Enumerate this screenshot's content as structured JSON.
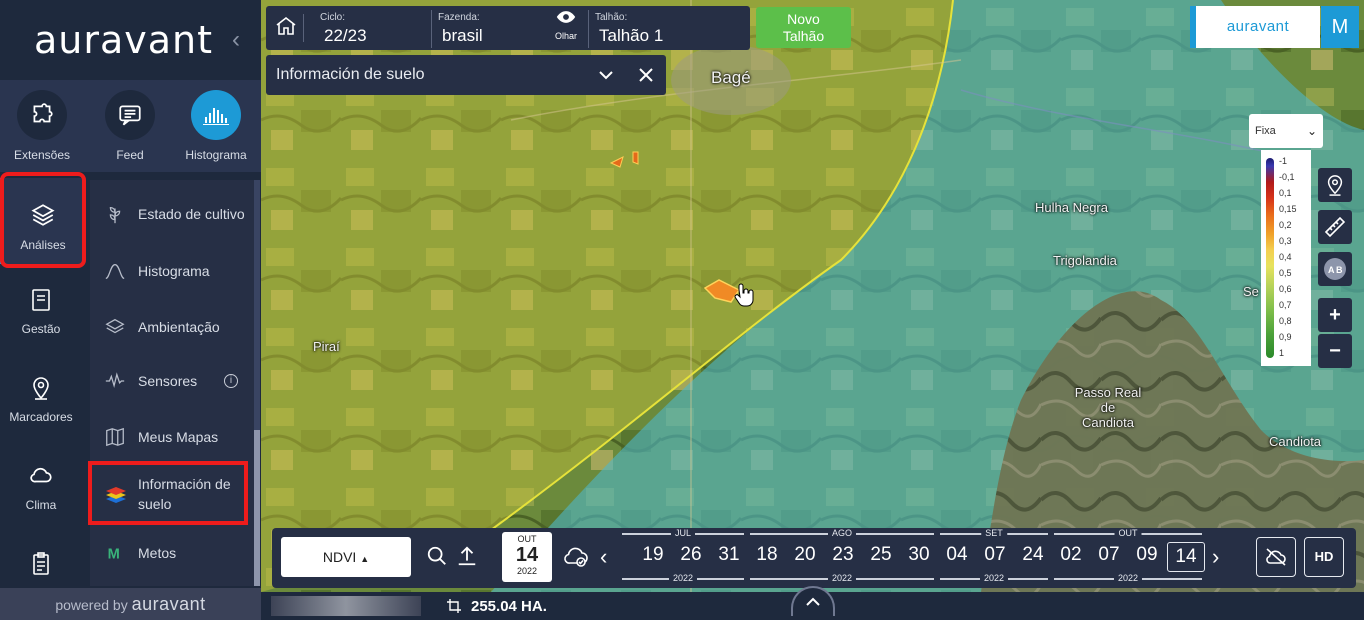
{
  "sidebar": {
    "logo": "auravant",
    "top_tools": [
      {
        "label": "Extensões",
        "icon": "puzzle-icon"
      },
      {
        "label": "Feed",
        "icon": "feed-icon"
      },
      {
        "label": "Histograma",
        "icon": "histogram-icon"
      }
    ],
    "rail": [
      {
        "label": "Análises",
        "icon": "layers-icon"
      },
      {
        "label": "Gestão",
        "icon": "clipboard-icon"
      },
      {
        "label": "Marcadores",
        "icon": "pin-icon"
      },
      {
        "label": "Clima",
        "icon": "cloud-icon"
      }
    ],
    "submenu": [
      {
        "label": "Estado de cultivo",
        "icon": "crop-state-icon"
      },
      {
        "label": "Histograma",
        "icon": "bell-curve-icon"
      },
      {
        "label": "Ambientação",
        "icon": "layers-icon"
      },
      {
        "label": "Sensores",
        "icon": "sensor-wave-icon"
      },
      {
        "label": "Meus Mapas",
        "icon": "map-icon"
      },
      {
        "label": "Información de suelo",
        "icon": "soil-layers-icon"
      },
      {
        "label": "Metos",
        "icon": "metos-icon"
      }
    ],
    "powered_by": "powered by",
    "powered_brand": "auravant"
  },
  "topbar": {
    "ciclo_label": "Ciclo:",
    "ciclo_value": "22/23",
    "fazenda_label": "Fazenda:",
    "fazenda_value": "brasil",
    "olhar_label": "Olhar",
    "talhao_label": "Talhão:",
    "talhao_value": "Talhão 1",
    "novo_label_1": "Novo",
    "novo_label_2": "Talhão"
  },
  "info_panel": {
    "title": "Información de suelo"
  },
  "brand_box": {
    "text": "auravant",
    "avatar": "M"
  },
  "scale": {
    "selected": "Fixa"
  },
  "legend": {
    "values": [
      "-1",
      "-0,1",
      "0,1",
      "0,15",
      "0,2",
      "0,3",
      "0,4",
      "0,5",
      "0,6",
      "0,7",
      "0,8",
      "0,9",
      "1"
    ]
  },
  "map": {
    "labels": [
      "Bagé",
      "Hulha Negra",
      "Trigolandia",
      "Piraí",
      "Passo Real de Candiota",
      "Candiota",
      "Se"
    ]
  },
  "bottombar": {
    "index": "NDVI",
    "date_month": "OUT",
    "date_day": "14",
    "date_year": "2022",
    "months": [
      {
        "name": "JUL",
        "year": "2022",
        "days": [
          "19",
          "26",
          "31"
        ]
      },
      {
        "name": "AGO",
        "year": "2022",
        "days": [
          "18",
          "20",
          "23",
          "25",
          "30"
        ]
      },
      {
        "name": "SET",
        "year": "2022",
        "days": [
          "04",
          "07",
          "24"
        ]
      },
      {
        "name": "OUT",
        "year": "2022",
        "days": [
          "02",
          "07",
          "09",
          "14"
        ]
      }
    ],
    "selected_day": "14",
    "hd_label": "HD"
  },
  "status": {
    "area": "255.04 HA."
  }
}
